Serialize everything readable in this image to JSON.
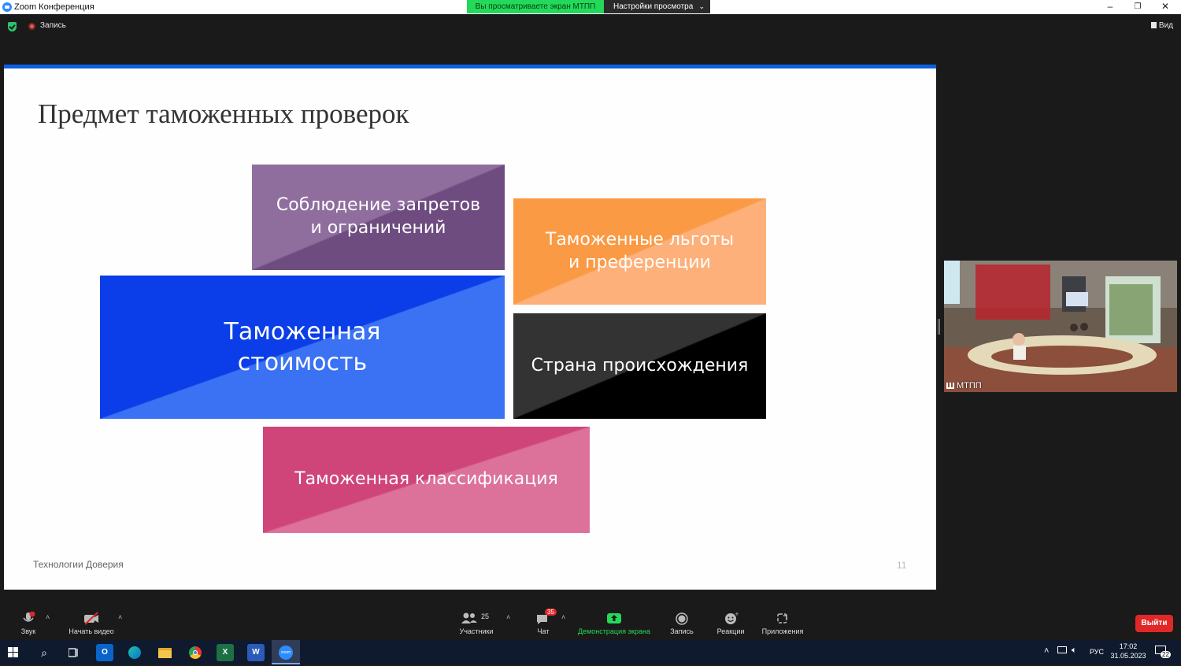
{
  "window": {
    "title": "Zoom Конференция"
  },
  "share": {
    "banner": "Вы просматриваете экран МТПП",
    "view_options": "Настройки просмотра"
  },
  "topbar": {
    "recording": "Запись",
    "view": "Вид"
  },
  "slide": {
    "title": "Предмет таможенных проверок",
    "boxes": {
      "b1": "Соблюдение запретов\nи ограничений",
      "b2": "Таможенные льготы\nи преференции",
      "b3": "Таможенная\nстоимость",
      "b4": "Страна происхождения",
      "b5": "Таможенная классификация"
    },
    "footer": "Технологии Доверия",
    "page": "11"
  },
  "participant": {
    "name": "МТПП"
  },
  "toolbar": {
    "audio": "Звук",
    "video": "Начать видео",
    "participants": "Участники",
    "participants_count": "25",
    "chat": "Чат",
    "chat_badge": "35",
    "share": "Демонстрация экрана",
    "record": "Запись",
    "reactions": "Реакции",
    "apps": "Приложения",
    "leave": "Выйти"
  },
  "taskbar": {
    "lang": "РУС",
    "time": "17:02",
    "date": "31.05.2023",
    "notifications": "22",
    "zoom_label": "zoom"
  },
  "colors": {
    "purple": "#7d5b8e",
    "orange": "#fb9d4c",
    "blue": "#0b3fe8",
    "black": "#111111",
    "pink": "#cf4f82"
  }
}
